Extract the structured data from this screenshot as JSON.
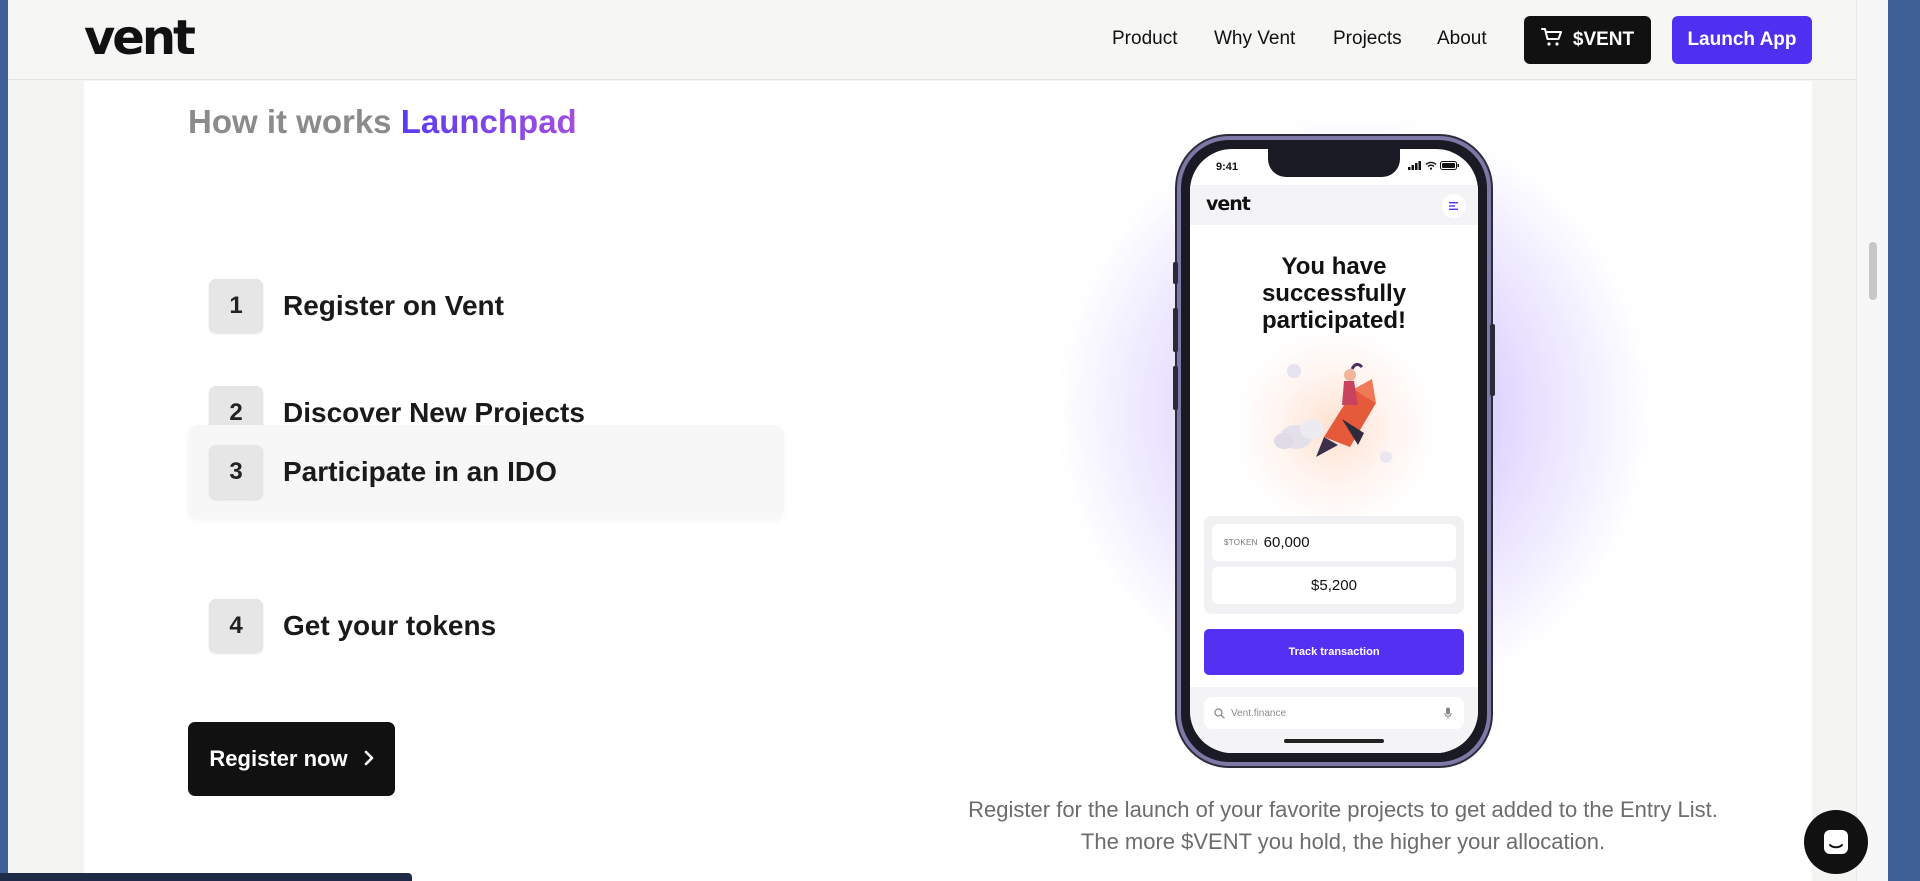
{
  "header": {
    "logo": "vent",
    "nav": [
      "Product",
      "Why Vent",
      "Projects",
      "About"
    ],
    "vent_button": "$VENT",
    "launch_button": "Launch App"
  },
  "section": {
    "heading_muted": "How it works",
    "heading_accent": "Launchpad",
    "steps": [
      {
        "num": "1",
        "label": "Register on Vent"
      },
      {
        "num": "2",
        "label": "Discover New Projects"
      },
      {
        "num": "3",
        "label": "Participate in an IDO"
      },
      {
        "num": "4",
        "label": "Get your tokens"
      }
    ],
    "register_button": "Register now",
    "caption": "Register for the launch of your favorite projects to get added to the Entry List. The more $VENT you hold, the higher your allocation."
  },
  "phone": {
    "time": "9:41",
    "app_logo": "vent",
    "title": "You have successfully participated!",
    "token_tag": "$TOKEN",
    "token_amount": "60,000",
    "usd_amount": "$5,200",
    "track_button": "Track transaction",
    "url": "Vent.finance"
  },
  "colors": {
    "brand_purple": "#4f2ff0",
    "accent_gradient_start": "#5b3bf0",
    "accent_gradient_end": "#a34fe0",
    "dark": "#111111"
  },
  "icons": [
    "cart-icon",
    "chevron-right-icon",
    "search-icon",
    "mic-icon",
    "menu-icon",
    "chat-icon"
  ]
}
